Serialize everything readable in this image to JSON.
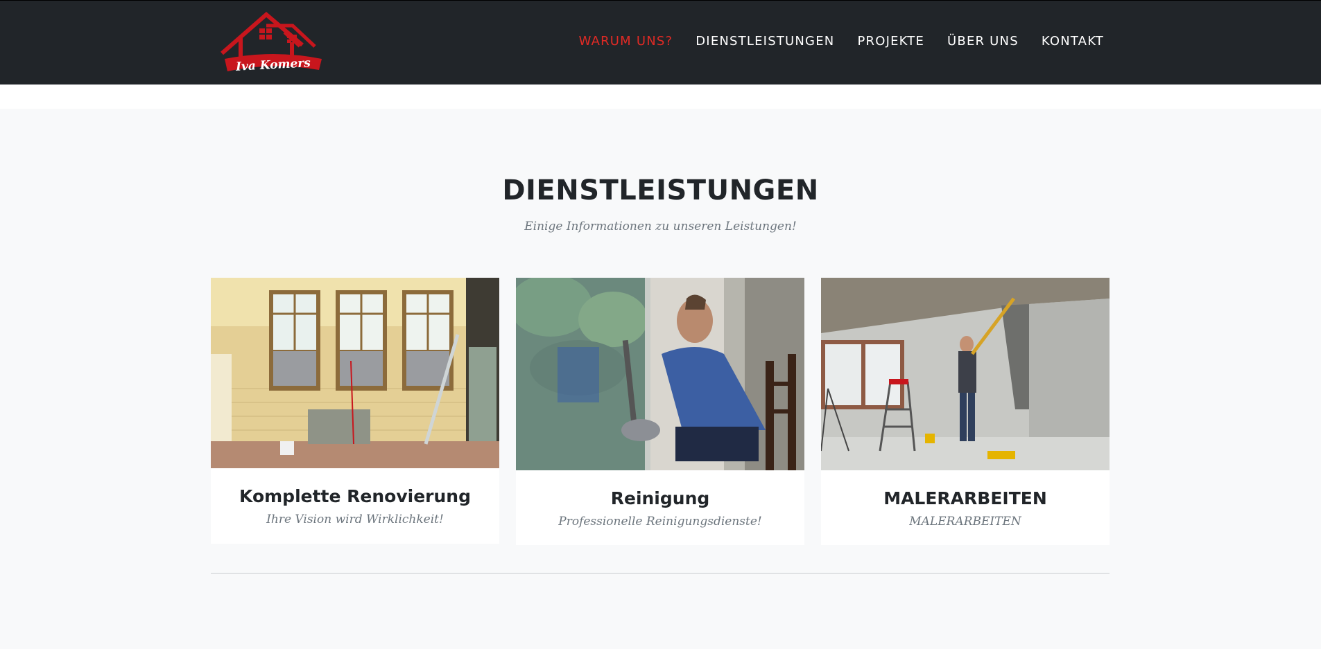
{
  "brand": {
    "logo_text": "Iva Komers",
    "colors": {
      "logo_red": "#c8161d",
      "accent": "#e12a25",
      "navbar": "#212529"
    }
  },
  "nav": {
    "items": [
      {
        "label": "WARUM UNS?",
        "active": true
      },
      {
        "label": "DIENSTLEISTUNGEN",
        "active": false
      },
      {
        "label": "PROJEKTE",
        "active": false
      },
      {
        "label": "ÜBER UNS",
        "active": false
      },
      {
        "label": "KONTAKT",
        "active": false
      }
    ]
  },
  "services": {
    "title": "DIENSTLEISTUNGEN",
    "subtitle": "Einige Informationen zu unseren Leistungen!",
    "cards": [
      {
        "name": "Komplette Renovierung",
        "description": "Ihre Vision wird Wirklichkeit!",
        "image": "renovation-room-photo"
      },
      {
        "name": "Reinigung",
        "description": "Professionelle Reinigungsdienste!",
        "image": "window-cleaner-photo"
      },
      {
        "name": "MALERARBEITEN",
        "description": "MALERARBEITEN",
        "image": "wall-painter-photo"
      }
    ]
  }
}
